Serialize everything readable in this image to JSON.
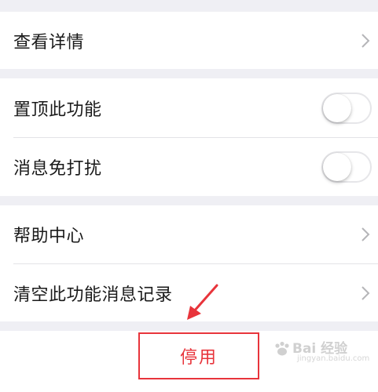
{
  "sections": {
    "details": {
      "label": "查看详情"
    },
    "settings": [
      {
        "label": "置顶此功能",
        "on": false
      },
      {
        "label": "消息免打扰",
        "on": false
      }
    ],
    "help": {
      "label": "帮助中心"
    },
    "clear": {
      "label": "清空此功能消息记录"
    }
  },
  "disable_button": {
    "label": "停用",
    "color": "#e8343b"
  },
  "watermark": {
    "text": "Bai 经验",
    "sub": "jingyan.baidu.com"
  },
  "icons": {
    "chevron": "chevron-right-icon",
    "arrow": "annotation-arrow-icon",
    "paw": "baidu-paw-icon"
  }
}
